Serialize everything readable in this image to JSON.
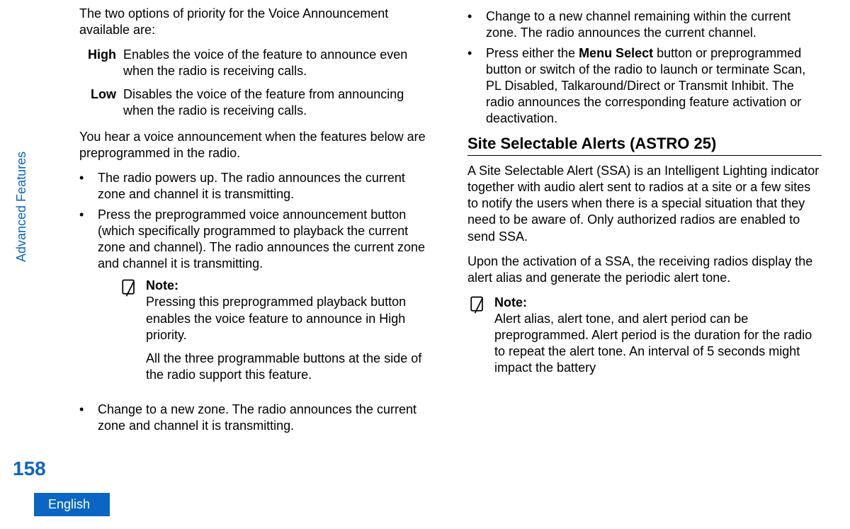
{
  "sidebar": {
    "section_vertical": "Advanced Features",
    "page_number": "158",
    "language": "English"
  },
  "col1": {
    "intro": "The two options of priority for the Voice Announcement available are:",
    "defs": {
      "high_label": "High",
      "high_text": "Enables the voice of the feature to announce even when the radio is receiving calls.",
      "low_label": "Low",
      "low_text": "Disables the voice of the feature from announcing when the radio is receiving calls."
    },
    "para2": "You hear a voice announcement when the features below are preprogrammed in the radio.",
    "bullets": {
      "b1": "The radio powers up. The radio announces the current zone and channel it is transmitting.",
      "b2": "Press the preprogrammed voice announcement button (which specifically programmed to playback the current zone and channel). The radio announces the current zone and channel it is transmitting.",
      "b3": "Change to a new zone. The radio announces the current zone and channel it is transmitting."
    },
    "note": {
      "title": "Note:",
      "p1": "Pressing this preprogrammed playback button enables the voice feature to announce in High priority.",
      "p2": "All the three programmable buttons at the side of the radio support this feature."
    }
  },
  "col2": {
    "bullets": {
      "b1": "Change to a new channel remaining within the current zone. The radio announces the current channel.",
      "b2_prefix": "Press either the ",
      "b2_bold": "Menu Select",
      "b2_suffix": " button or preprogrammed button or switch of the radio to launch or terminate Scan, PL Disabled, Talkaround/Direct or Transmit Inhibit. The radio announces the corresponding feature activation or deactivation."
    },
    "heading": "Site Selectable Alerts (ASTRO 25)",
    "p1": "A Site Selectable Alert (SSA) is an Intelligent Lighting indicator together with audio alert sent to radios at a site or a few sites to notify the users when there is a special situation that they need to be aware of. Only authorized radios are enabled to send SSA.",
    "p2": "Upon the activation of a SSA, the receiving radios display the alert alias and generate the periodic alert tone.",
    "note": {
      "title": "Note:",
      "p1": "Alert alias, alert tone, and alert period can be preprogrammed. Alert period is the duration for the radio to repeat the alert tone. An interval of 5 seconds might impact the battery"
    }
  }
}
